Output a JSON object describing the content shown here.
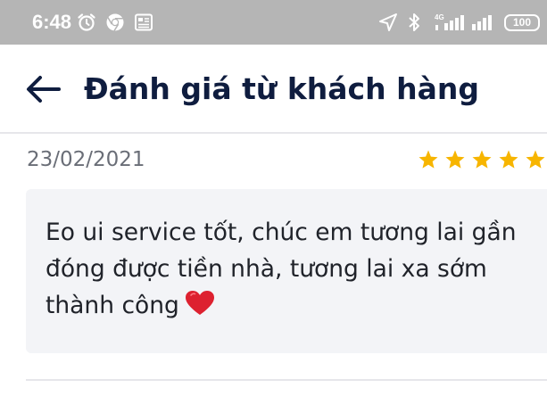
{
  "status_bar": {
    "time": "6:48",
    "network": "4G",
    "battery": "100",
    "icons": [
      "alarm-icon",
      "chrome-icon",
      "news-icon",
      "location-icon",
      "bluetooth-icon",
      "signal-icon",
      "signal-icon",
      "battery-icon"
    ]
  },
  "header": {
    "back_icon": "arrow-left-icon",
    "title": "Đánh giá từ khách hàng"
  },
  "review": {
    "date": "23/02/2021",
    "rating": 5,
    "comment": "Eo ui service tốt, chúc em tương lai gần đóng được tiền nhà, tương lai xa sớm thành công",
    "comment_icon": "heart-icon"
  },
  "colors": {
    "status_bar_bg": "#b5b5b5",
    "title": "#0f1d3f",
    "star": "#f7b500",
    "heart": "#dd2130",
    "comment_bg": "#f3f4f7"
  }
}
